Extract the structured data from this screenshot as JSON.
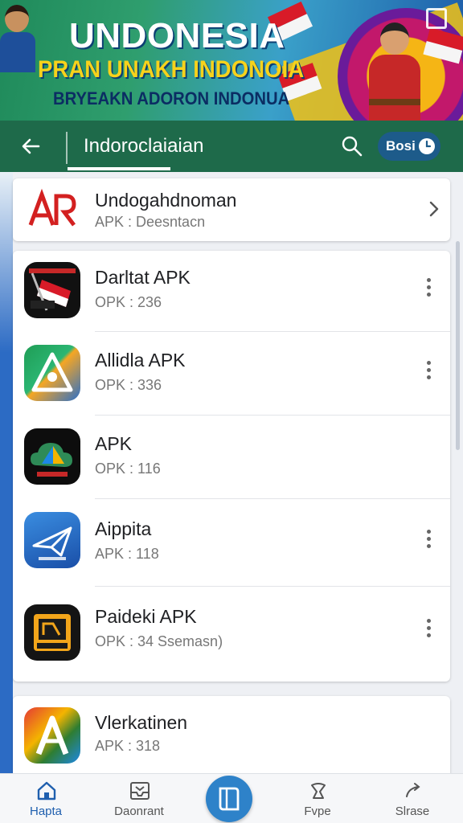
{
  "banner": {
    "title": "UNDONESIA",
    "subtitle": "PRAN UNAKH INDONOIA",
    "tagline": "BRYEAKN ADORON INDONUA"
  },
  "appbar": {
    "back_icon": "back-arrow-icon",
    "title": "Indoroclaiaian",
    "search_icon": "search-icon",
    "pill_label": "Bosi",
    "pill_icon": "clock-icon"
  },
  "top_item": {
    "name": "Undogahdnoman",
    "meta": "APK :  Deesntacn"
  },
  "apps": [
    {
      "name": "Darltat APK",
      "meta": "OPK : 236",
      "icon": "flag-app-icon"
    },
    {
      "name": "Allidla APK",
      "meta": "OPK : 336",
      "icon": "triangle-app-icon"
    },
    {
      "name": "APK",
      "meta": "OPK : 116",
      "icon": "cloud-app-icon"
    },
    {
      "name": "Aippita",
      "meta": "APK : 118",
      "icon": "paper-plane-app-icon"
    },
    {
      "name": "Paideki APK",
      "meta": "OPK : 34  Ssemasn)",
      "icon": "epbo-app-icon"
    }
  ],
  "bottom_item": {
    "name": "Vlerkatinen",
    "meta": "APK : 318",
    "icon": "gradient-a-app-icon"
  },
  "nav": [
    {
      "label": "Hapta",
      "icon": "home-icon"
    },
    {
      "label": "Daonrant",
      "icon": "inbox-icon"
    },
    {
      "label": "",
      "icon": "book-icon"
    },
    {
      "label": "Fvpe",
      "icon": "type-icon"
    },
    {
      "label": "Slrase",
      "icon": "share-icon"
    }
  ],
  "colors": {
    "appbar": "#1e6a4a",
    "accent": "#2e82c9",
    "card": "#ffffff"
  }
}
